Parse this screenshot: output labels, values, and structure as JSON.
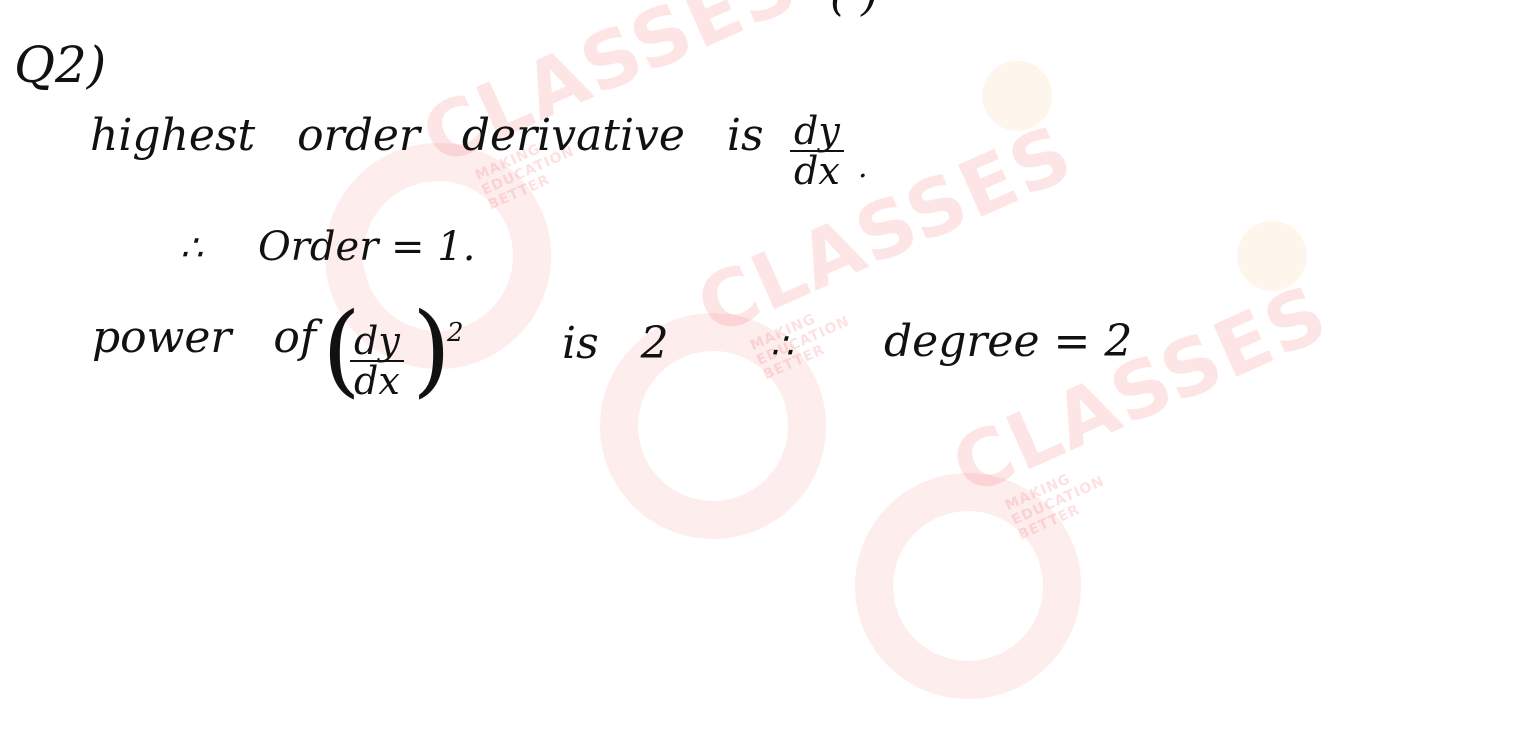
{
  "watermark": {
    "brand": "CLASSES",
    "tagline": "MAKING EDUCATION BETTER"
  },
  "top_fragment": "( )",
  "question_label": "Q2)",
  "line1": {
    "text": "highest   order   derivative   is",
    "frac_num": "dy",
    "frac_den": "dx",
    "end": "."
  },
  "line2": {
    "therefore": "∴",
    "text": "Order = 1."
  },
  "line3": {
    "power_of": "power   of",
    "frac_num": "dy",
    "frac_den": "dx",
    "exponent": "2",
    "is": "is   2",
    "therefore": "∴",
    "degree": "degree = 2"
  }
}
